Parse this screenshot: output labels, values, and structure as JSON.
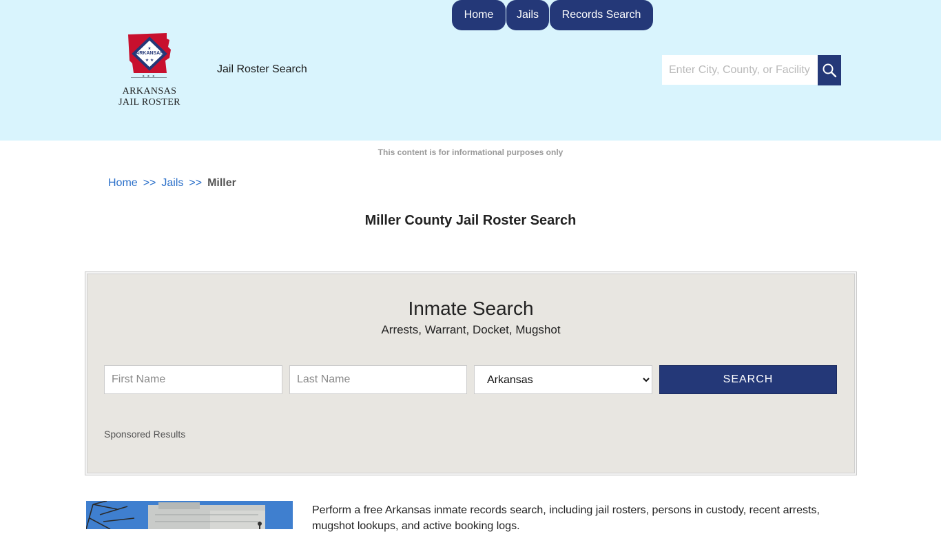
{
  "header": {
    "logo": {
      "line1": "ARKANSAS",
      "line2": "JAIL ROSTER",
      "flag_text": "ARKANSAS"
    },
    "tagline": "Jail Roster Search",
    "nav": [
      {
        "label": "Home"
      },
      {
        "label": "Jails"
      },
      {
        "label": "Records Search"
      }
    ],
    "search": {
      "placeholder": "Enter City, County, or Facility",
      "icon": "search-icon"
    },
    "colors": {
      "background": "#d9f4fd",
      "nav": "#243878"
    }
  },
  "disclaimer": "This content is for informational purposes only",
  "breadcrumb": {
    "items": [
      {
        "label": "Home"
      },
      {
        "label": "Jails"
      }
    ],
    "separator": ">>",
    "current": "Miller"
  },
  "page_title": "Miller County Jail Roster Search",
  "inmate_search": {
    "title": "Inmate Search",
    "subtitle": "Arrests, Warrant, Docket, Mugshot",
    "first_name_placeholder": "First Name",
    "last_name_placeholder": "Last Name",
    "state_selected": "Arkansas",
    "submit_label": "SEARCH",
    "sponsored": "Sponsored Results"
  },
  "intro_text": "Perform a free Arkansas inmate records search, including jail rosters, persons in custody, recent arrests, mugshot lookups, and active booking logs."
}
